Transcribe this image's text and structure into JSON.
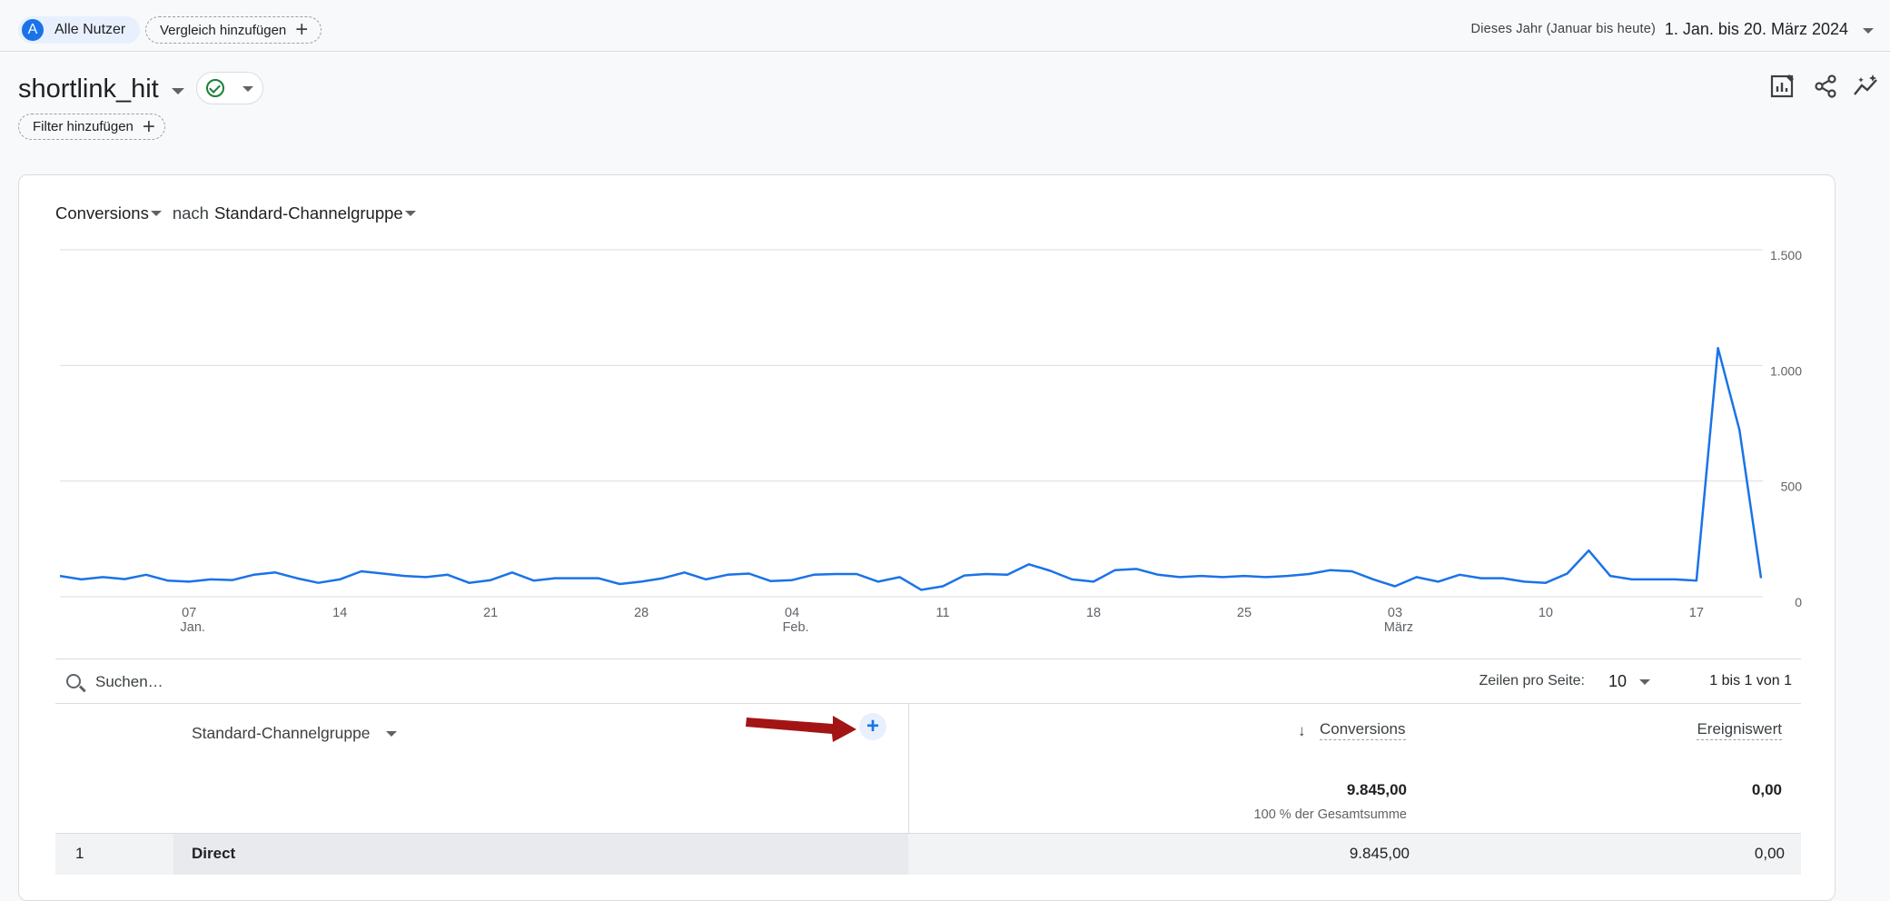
{
  "topbar": {
    "segment_initial": "A",
    "segment_label": "Alle Nutzer",
    "compare_label": "Vergleich hinzufügen",
    "date_preset": "Dieses Jahr (Januar bis heute)",
    "date_range": "1. Jan. bis 20. März 2024"
  },
  "report": {
    "title": "shortlink_hit",
    "filter_label": "Filter hinzufügen"
  },
  "card": {
    "metric": "Conversions",
    "connector": "nach",
    "dimension": "Standard-Channelgruppe"
  },
  "chart_data": {
    "type": "line",
    "series": [
      {
        "values": [
          90,
          75,
          85,
          76,
          95,
          70,
          65,
          75,
          72,
          95,
          105,
          80,
          60,
          75,
          110,
          100,
          90,
          85,
          95,
          60,
          72,
          105,
          70,
          80,
          80,
          80,
          55,
          65,
          80,
          105,
          75,
          95,
          100,
          68,
          72,
          95,
          98,
          98,
          65,
          85,
          30,
          45,
          92,
          98,
          95,
          140,
          112,
          75,
          65,
          115,
          120,
          95,
          85,
          90,
          85,
          90,
          85,
          90,
          98,
          115,
          110,
          75,
          45,
          85,
          65,
          95,
          80,
          80,
          65,
          60,
          100,
          200,
          90,
          75,
          75,
          75,
          70,
          1075,
          720,
          80
        ]
      }
    ],
    "ylim": [
      0,
      1500
    ],
    "yticks": [
      "1.500",
      "1.000",
      "500",
      "0"
    ],
    "ytick_values": [
      1500,
      1000,
      500,
      0
    ],
    "xticks": [
      {
        "index": 6,
        "label": "07",
        "sub": "Jan."
      },
      {
        "index": 13,
        "label": "14",
        "sub": ""
      },
      {
        "index": 20,
        "label": "21",
        "sub": ""
      },
      {
        "index": 27,
        "label": "28",
        "sub": ""
      },
      {
        "index": 34,
        "label": "04",
        "sub": "Feb."
      },
      {
        "index": 41,
        "label": "11",
        "sub": ""
      },
      {
        "index": 48,
        "label": "18",
        "sub": ""
      },
      {
        "index": 55,
        "label": "25",
        "sub": ""
      },
      {
        "index": 62,
        "label": "03",
        "sub": "März"
      },
      {
        "index": 69,
        "label": "10",
        "sub": ""
      },
      {
        "index": 76,
        "label": "17",
        "sub": ""
      }
    ],
    "color": "#1a73e8"
  },
  "table": {
    "search_placeholder": "Suchen…",
    "rows_per_page_label": "Zeilen pro Seite:",
    "rows_per_page_value": "10",
    "page_info": "1 bis 1 von 1",
    "dimension_header": "Standard-Channelgruppe",
    "add_dimension_symbol": "+",
    "sort_symbol": "↓",
    "columns": [
      "Conversions",
      "Ereigniswert"
    ],
    "totals": [
      "9.845,00",
      "0,00"
    ],
    "totals_sub": "100 % der Gesamtsumme",
    "rows": [
      {
        "num": "1",
        "dim": "Direct",
        "conversions": "9.845,00",
        "value": "0,00"
      }
    ]
  }
}
